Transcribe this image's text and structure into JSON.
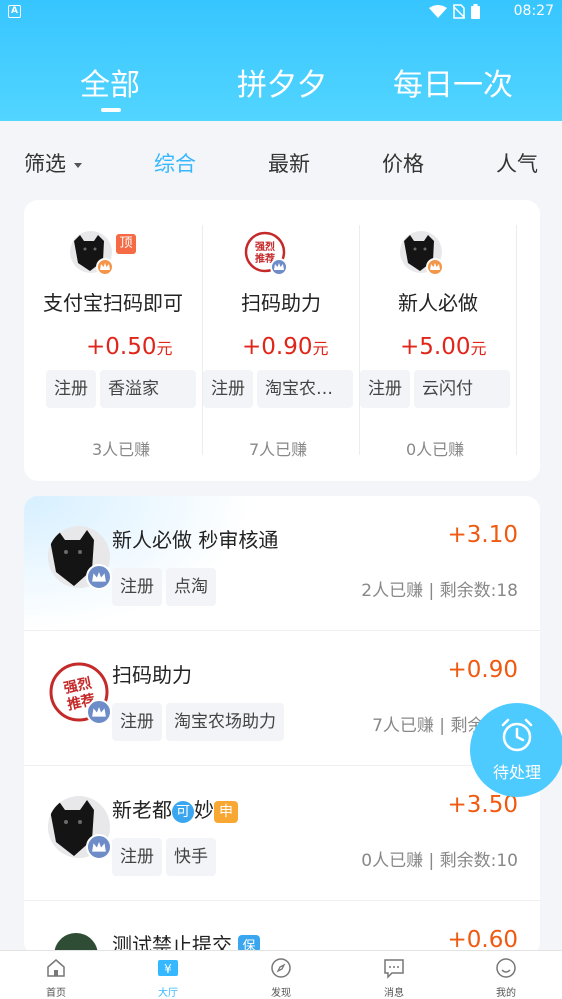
{
  "status_bar": {
    "time": "08:27"
  },
  "top_tabs": [
    {
      "label": "全部"
    },
    {
      "label": "拼夕夕"
    },
    {
      "label": "每日一次"
    }
  ],
  "filter_bar": {
    "filter_label": "筛选",
    "sorts": [
      {
        "label": "综合"
      },
      {
        "label": "最新"
      },
      {
        "label": "价格"
      },
      {
        "label": "人气"
      }
    ]
  },
  "featured": [
    {
      "title": "支付宝扫码即可",
      "amount": "+0.50",
      "unit": "元",
      "tags": [
        "注册",
        "香溢家"
      ],
      "earned": "3人已赚",
      "pin_label": "顶"
    },
    {
      "title": "扫码助力",
      "amount": "+0.90",
      "unit": "元",
      "tags": [
        "注册",
        "淘宝农…"
      ],
      "earned": "7人已赚"
    },
    {
      "title": "新人必做",
      "amount": "+5.00",
      "unit": "元",
      "tags": [
        "注册",
        "云闪付"
      ],
      "earned": "0人已赚"
    }
  ],
  "stamp_text": {
    "line1": "强烈",
    "line2": "推荐"
  },
  "tasks": [
    {
      "title": "新人必做 秒审核通",
      "price": "+3.10",
      "tags": [
        "注册",
        "点淘"
      ],
      "earned": "2人已赚",
      "remaining": "剩余数:18"
    },
    {
      "title": "扫码助力",
      "price": "+0.90",
      "tags": [
        "注册",
        "淘宝农场助力"
      ],
      "earned": "7人已赚",
      "remaining": "剩余数:6"
    },
    {
      "title": "新老都",
      "badge1": "可",
      "title_mid": "妙",
      "badge2": "申",
      "price": "+3.50",
      "tags": [
        "注册",
        "快手"
      ],
      "earned": "0人已赚",
      "remaining": "剩余数:10"
    },
    {
      "title": "测试禁止提交",
      "badge3": "保",
      "price": "+0.60"
    }
  ],
  "pending_button": {
    "label": "待处理"
  },
  "bottom_nav": [
    {
      "label": "首页",
      "icon": "home-icon"
    },
    {
      "label": "大厅",
      "icon": "hall-icon"
    },
    {
      "label": "发现",
      "icon": "compass-icon"
    },
    {
      "label": "消息",
      "icon": "message-icon"
    },
    {
      "label": "我的",
      "icon": "profile-icon"
    }
  ],
  "colors": {
    "header": "#37c5ff",
    "accent": "#35b8ff",
    "price": "#f0590f",
    "featured_price": "#e0251b"
  }
}
